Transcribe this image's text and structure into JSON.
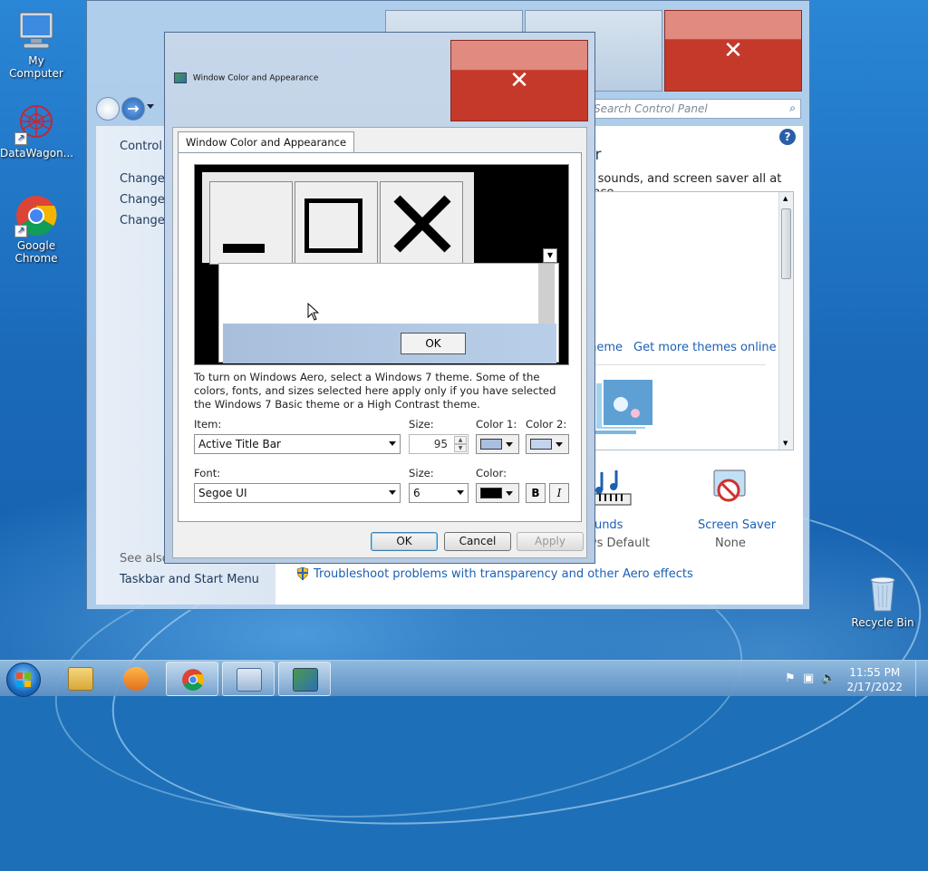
{
  "desktop": {
    "icons": [
      {
        "label": "My Computer"
      },
      {
        "label": "DataWagon..."
      },
      {
        "label": "Google Chrome"
      },
      {
        "label": "Recycle Bin"
      }
    ]
  },
  "control_panel": {
    "search_placeholder": "Search Control Panel",
    "breadcrumb": "Control P",
    "left_links": [
      "Change d",
      "Change m",
      "Change y"
    ],
    "see_also": "See also",
    "see_also_link": "Taskbar and Start Menu",
    "heading_fragment": "er",
    "subtitle_fragment": "r, sounds, and screen saver all at once.",
    "theme_link": "theme",
    "more_themes_link": "Get more themes online",
    "sounds_label": "ounds",
    "sounds_value": "ws Default",
    "screensaver_label": "Screen Saver",
    "screensaver_value": "None",
    "troubleshoot_link": "Troubleshoot problems with transparency and other Aero effects"
  },
  "dialog": {
    "title": "Window Color and Appearance",
    "tab_label": "Window Color and Appearance",
    "preview_ok": "OK",
    "description": "To turn on Windows Aero, select a Windows 7 theme.  Some of the colors, fonts, and sizes selected here apply only if you have selected the Windows 7 Basic theme or a High Contrast theme.",
    "item_label": "Item:",
    "item_value": "Active Title Bar",
    "size_label": "Size:",
    "size_value": "95",
    "color1_label": "Color 1:",
    "color2_label": "Color 2:",
    "font_label": "Font:",
    "font_value": "Segoe UI",
    "font_size_label": "Size:",
    "font_size_value": "6",
    "font_color_label": "Color:",
    "bold_label": "B",
    "italic_label": "I",
    "ok_label": "OK",
    "cancel_label": "Cancel",
    "apply_label": "Apply",
    "colors": {
      "color1": "#a9bfdf",
      "color2": "#c2d4ee",
      "font_color": "#000000"
    }
  },
  "taskbar": {
    "time": "11:55 PM",
    "date": "2/17/2022",
    "apps": [
      "explorer",
      "media-player",
      "chrome",
      "control-panel",
      "display-settings"
    ]
  }
}
